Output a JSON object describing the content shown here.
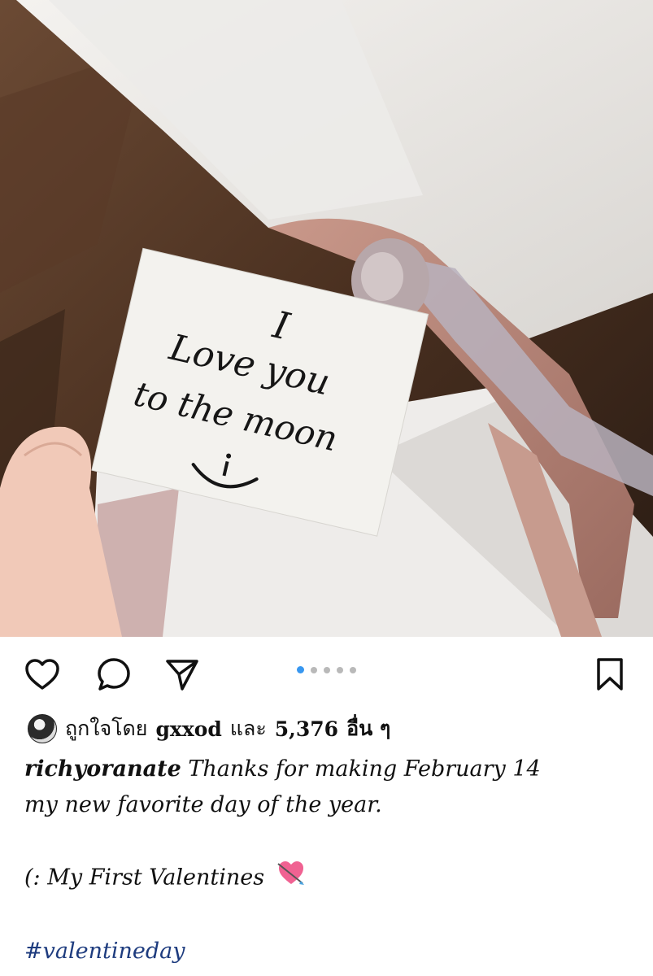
{
  "post": {
    "photo_alt": "photo",
    "note_lines": [
      "I",
      "Love you",
      "to the moon",
      ":)"
    ],
    "carousel": {
      "count": 5,
      "active_index": 0
    }
  },
  "likes": {
    "prefix": "ถูกใจโดย",
    "user": "gxxod",
    "conj": "และ",
    "count": "5,376",
    "suffix": "อื่น ๆ"
  },
  "caption": {
    "username": "richyoranate",
    "line1": "Thanks for making February 14",
    "line2": "my new favorite day of the year.",
    "line3": "(: My First Valentines",
    "hashtag": "#valentineday"
  },
  "colors": {
    "accent_dot": "#3897f0",
    "hashtag": "#1d3b7e"
  },
  "icons": [
    "heart-icon",
    "comment-icon",
    "share-icon",
    "bookmark-icon",
    "heart-with-arrow-emoji"
  ]
}
